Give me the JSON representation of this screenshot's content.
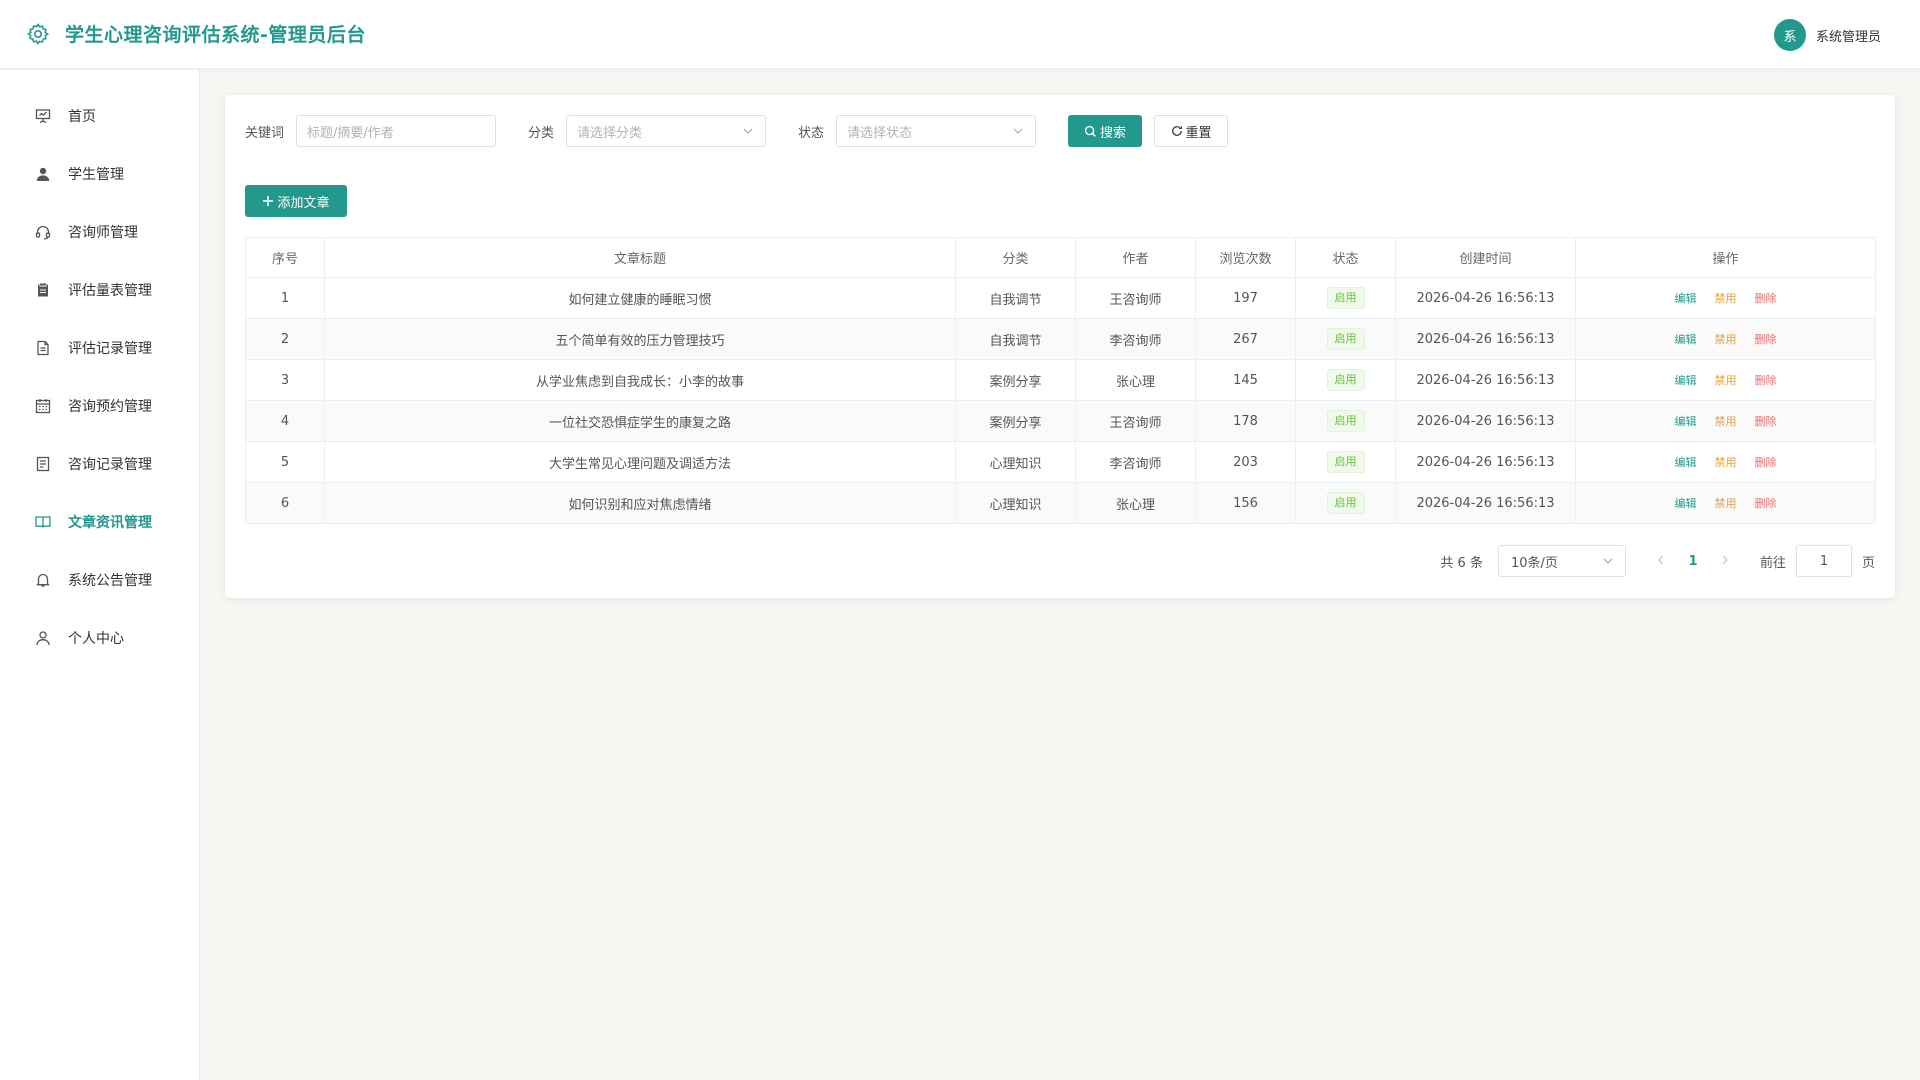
{
  "header": {
    "title": "学生心理咨询评估系统-管理员后台",
    "avatar_text": "系",
    "user_name": "系统管理员"
  },
  "sidebar": {
    "items": [
      {
        "label": "首页",
        "icon": "presentation-icon"
      },
      {
        "label": "学生管理",
        "icon": "user-icon"
      },
      {
        "label": "咨询师管理",
        "icon": "headset-icon"
      },
      {
        "label": "评估量表管理",
        "icon": "clipboard-icon"
      },
      {
        "label": "评估记录管理",
        "icon": "document-icon"
      },
      {
        "label": "咨询预约管理",
        "icon": "calendar-icon"
      },
      {
        "label": "咨询记录管理",
        "icon": "notes-icon"
      },
      {
        "label": "文章资讯管理",
        "icon": "book-icon",
        "active": true
      },
      {
        "label": "系统公告管理",
        "icon": "bell-icon"
      },
      {
        "label": "个人中心",
        "icon": "person-icon"
      }
    ]
  },
  "search": {
    "keyword_label": "关键词",
    "keyword_placeholder": "标题/摘要/作者",
    "category_label": "分类",
    "category_placeholder": "请选择分类",
    "status_label": "状态",
    "status_placeholder": "请选择状态",
    "search_button": "搜索",
    "reset_button": "重置"
  },
  "toolbar": {
    "add_button": "添加文章"
  },
  "table": {
    "columns": [
      "序号",
      "文章标题",
      "分类",
      "作者",
      "浏览次数",
      "状态",
      "创建时间",
      "操作"
    ],
    "rows": [
      {
        "index": "1",
        "title": "如何建立健康的睡眠习惯",
        "category": "自我调节",
        "author": "王咨询师",
        "views": "197",
        "status": "启用",
        "created": "2026-04-26 16:56:13"
      },
      {
        "index": "2",
        "title": "五个简单有效的压力管理技巧",
        "category": "自我调节",
        "author": "李咨询师",
        "views": "267",
        "status": "启用",
        "created": "2026-04-26 16:56:13"
      },
      {
        "index": "3",
        "title": "从学业焦虑到自我成长：小李的故事",
        "category": "案例分享",
        "author": "张心理",
        "views": "145",
        "status": "启用",
        "created": "2026-04-26 16:56:13"
      },
      {
        "index": "4",
        "title": "一位社交恐惧症学生的康复之路",
        "category": "案例分享",
        "author": "王咨询师",
        "views": "178",
        "status": "启用",
        "created": "2026-04-26 16:56:13"
      },
      {
        "index": "5",
        "title": "大学生常见心理问题及调适方法",
        "category": "心理知识",
        "author": "李咨询师",
        "views": "203",
        "status": "启用",
        "created": "2026-04-26 16:56:13"
      },
      {
        "index": "6",
        "title": "如何识别和应对焦虑情绪",
        "category": "心理知识",
        "author": "张心理",
        "views": "156",
        "status": "启用",
        "created": "2026-04-26 16:56:13"
      }
    ],
    "actions": {
      "edit": "编辑",
      "disable": "禁用",
      "delete": "删除"
    }
  },
  "pagination": {
    "total_text": "共 6 条",
    "page_size": "10条/页",
    "current_page": "1",
    "goto_label": "前往",
    "goto_value": "1",
    "page_suffix": "页"
  },
  "colors": {
    "accent": "#23998e",
    "success": "#67c23a",
    "warning": "#e6a23c",
    "danger": "#f56c6c"
  }
}
